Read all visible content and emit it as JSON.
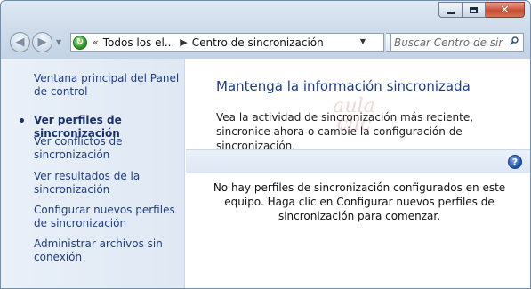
{
  "navigation": {
    "breadcrumb_prefix": "«",
    "breadcrumb": [
      "Todos los el...",
      "Centro de sincronización"
    ],
    "search_placeholder": "Buscar Centro de sin..."
  },
  "sidebar": {
    "items": [
      {
        "label": "Ventana principal del Panel de control",
        "current": false
      },
      {
        "label": "Ver perfiles de sincronización",
        "current": true
      },
      {
        "label": "Ver conflictos de sincronización",
        "current": false
      },
      {
        "label": "Ver resultados de la sincronización",
        "current": false
      },
      {
        "label": "Configurar nuevos perfiles de sincronización",
        "current": false
      },
      {
        "label": "Administrar archivos sin conexión",
        "current": false
      }
    ]
  },
  "main": {
    "heading": "Mantenga la información sincronizada",
    "description": "Vea la actividad de sincronización más reciente, sincronice ahora o cambie la configuración de sincronización.",
    "empty_message": "No hay perfiles de sincronización configurados en este equipo. Haga clic en Configurar nuevos perfiles de sincronización para comenzar.",
    "help_label": "?"
  },
  "watermark": {
    "line1": "aula",
    "line2": "clic"
  },
  "icons": {
    "back": "back-arrow-icon",
    "forward": "forward-arrow-icon",
    "location": "sync-center-icon",
    "refresh": "refresh-icon",
    "search": "search-icon",
    "help": "help-icon"
  },
  "colors": {
    "link": "#1f3d87",
    "heading": "#1c3e8a",
    "close_button": "#c84c30"
  }
}
